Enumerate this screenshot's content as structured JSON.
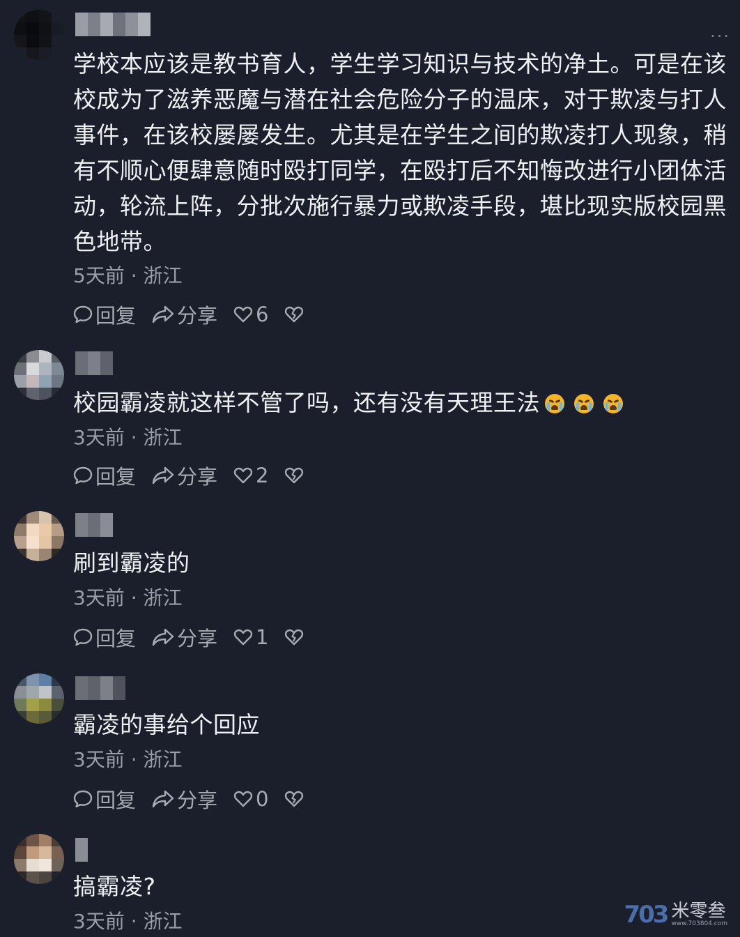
{
  "ui": {
    "reply_label": "回复",
    "share_label": "分享",
    "more_label": "···"
  },
  "comments": [
    {
      "text": "学校本应该是教书育人，学生学习知识与技术的净土。可是在该校成为了滋养恶魔与潜在社会危险分子的温床，对于欺凌与打人事件，在该校屡屡发生。尤其是在学生之间的欺凌打人现象，稍有不顺心便肆意随时殴打同学，在殴打后不知悔改进行小团体活动，轮流上阵，分批次施行暴力或欺凌手段，堪比现实版校园黑色地带。",
      "meta": "5天前 · 浙江",
      "likes": "6"
    },
    {
      "text": "校园霸凌就这样不管了吗，还有没有天理王法",
      "emojis": [
        "crying-emoji",
        "crying-emoji",
        "crying-emoji"
      ],
      "meta": "3天前 · 浙江",
      "likes": "2"
    },
    {
      "text": "刷到霸凌的",
      "meta": "3天前 · 浙江",
      "likes": "1"
    },
    {
      "text": "霸凌的事给个回应",
      "meta": "3天前 · 浙江",
      "likes": "0"
    },
    {
      "text": "搞霸凌?",
      "meta": "3天前 · 浙江"
    }
  ],
  "watermark": {
    "logo": "703",
    "name": "米零叁",
    "url": "www.703804.com"
  },
  "colors": {
    "background": "#1b1f2b",
    "text": "#eef0f3",
    "meta": "#9a9ea8",
    "action": "#a7abb4"
  }
}
